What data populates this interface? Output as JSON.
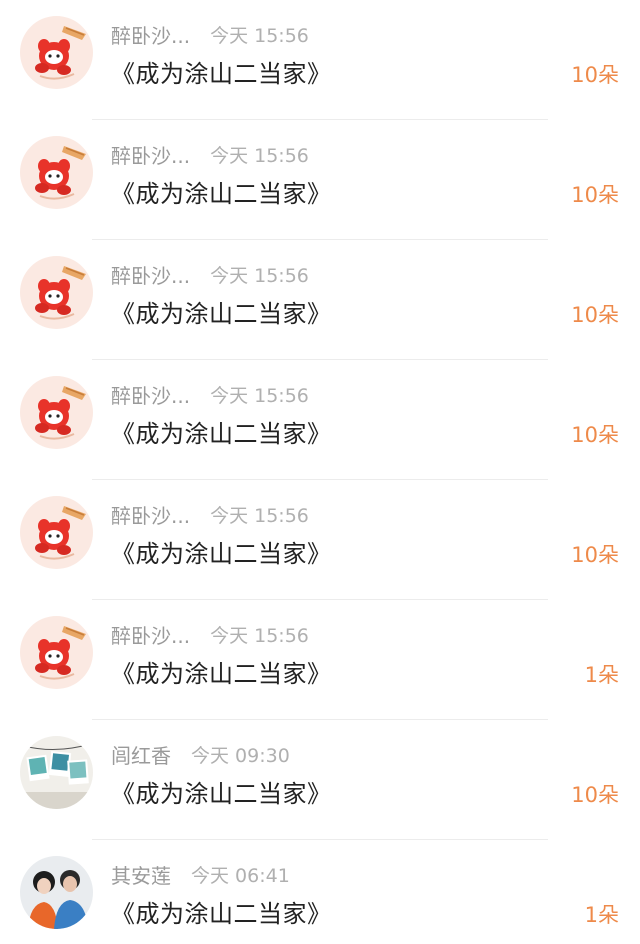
{
  "colors": {
    "accent": "#ee8a4a",
    "name_text": "#9a9a9a",
    "time_text": "#b0b0b0",
    "title_text": "#222222",
    "divider": "#ececec"
  },
  "items": [
    {
      "avatar_icon": "red-mascot-avatar-icon",
      "name": "醉卧沙...",
      "time": "今天 15:56",
      "title": "《成为涂山二当家》",
      "count": "10朵"
    },
    {
      "avatar_icon": "red-mascot-avatar-icon",
      "name": "醉卧沙...",
      "time": "今天 15:56",
      "title": "《成为涂山二当家》",
      "count": "10朵"
    },
    {
      "avatar_icon": "red-mascot-avatar-icon",
      "name": "醉卧沙...",
      "time": "今天 15:56",
      "title": "《成为涂山二当家》",
      "count": "10朵"
    },
    {
      "avatar_icon": "red-mascot-avatar-icon",
      "name": "醉卧沙...",
      "time": "今天 15:56",
      "title": "《成为涂山二当家》",
      "count": "10朵"
    },
    {
      "avatar_icon": "red-mascot-avatar-icon",
      "name": "醉卧沙...",
      "time": "今天 15:56",
      "title": "《成为涂山二当家》",
      "count": "10朵"
    },
    {
      "avatar_icon": "red-mascot-avatar-icon",
      "name": "醉卧沙...",
      "time": "今天 15:56",
      "title": "《成为涂山二当家》",
      "count": "1朵"
    },
    {
      "avatar_icon": "photos-avatar-icon",
      "name": "闾红香",
      "time": "今天 09:30",
      "title": "《成为涂山二当家》",
      "count": "10朵"
    },
    {
      "avatar_icon": "couple-avatar-icon",
      "name": "其安莲",
      "time": "今天 06:41",
      "title": "《成为涂山二当家》",
      "count": "1朵"
    }
  ]
}
